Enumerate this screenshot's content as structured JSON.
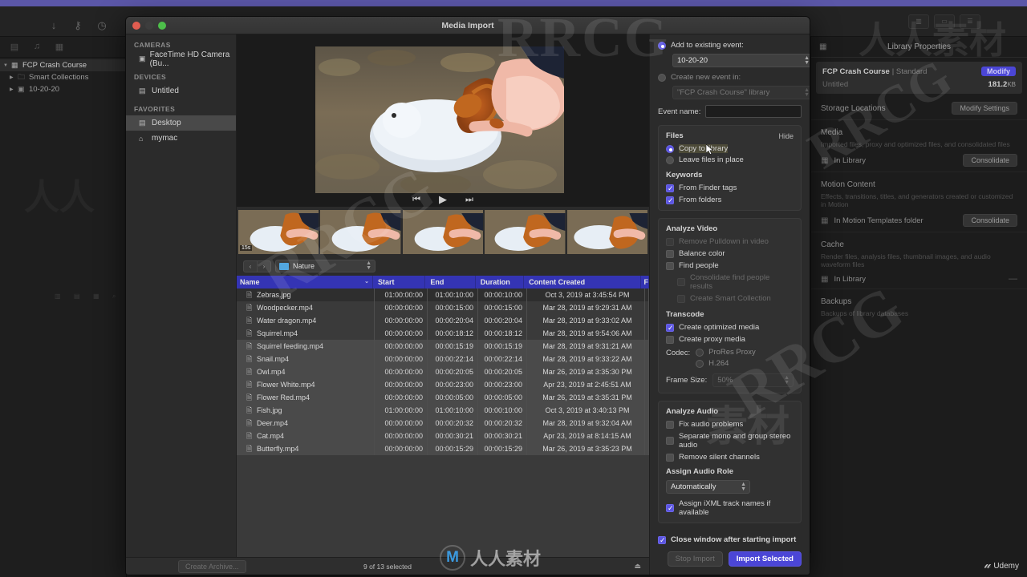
{
  "app": {
    "sidebar": {
      "items": [
        {
          "label": "FCP Crash Course",
          "icon": "library-icon",
          "level": 0
        },
        {
          "label": "Smart Collections",
          "icon": "folder-icon",
          "level": 1
        },
        {
          "label": "10-20-20",
          "icon": "event-icon",
          "level": 1
        }
      ]
    },
    "inspector": {
      "title": "Library Properties",
      "library_name": "FCP Crash Course",
      "library_kind": "Standard",
      "modify_label": "Modify",
      "untitled_label": "Untitled",
      "untitled_size": "181.2",
      "untitled_size_unit": "KB",
      "storage_title": "Storage Locations",
      "storage_button": "Modify Settings",
      "media_title": "Media",
      "media_desc": "Imported files, proxy and optimized files, and consolidated files",
      "media_location": "In Library",
      "media_button": "Consolidate",
      "motion_title": "Motion Content",
      "motion_desc": "Effects, transitions, titles, and generators created or customized in Motion",
      "motion_location": "In Motion Templates folder",
      "motion_button": "Consolidate",
      "cache_title": "Cache",
      "cache_desc": "Render files, analysis files, thumbnail images, and audio waveform files",
      "cache_location": "In Library",
      "backups_title": "Backups",
      "backups_desc": "Backups of library databases"
    }
  },
  "window": {
    "title": "Media Import",
    "sources": {
      "cameras_header": "CAMERAS",
      "cameras": [
        {
          "label": "FaceTime HD Camera (Bu...",
          "icon": "camera-icon"
        }
      ],
      "devices_header": "DEVICES",
      "devices": [
        {
          "label": "Untitled",
          "icon": "drive-icon"
        }
      ],
      "favorites_header": "FAVORITES",
      "favorites": [
        {
          "label": "Desktop",
          "icon": "desktop-icon",
          "selected": true
        },
        {
          "label": "mymac",
          "icon": "home-icon",
          "selected": false
        }
      ]
    },
    "viewer": {
      "skip_back_icon": "skip-back-icon",
      "play_icon": "play-icon",
      "skip_forward_icon": "skip-forward-icon",
      "filmstrip_badge": "15s"
    },
    "path_bar": {
      "back_icon": "chevron-left-icon",
      "forward_icon": "chevron-right-icon",
      "current_folder": "Nature"
    },
    "table": {
      "columns": [
        "Name",
        "Start",
        "End",
        "Duration",
        "Content Created",
        "F"
      ],
      "sort_column": "Name",
      "rows": [
        {
          "name": "Zebras.jpg",
          "start": "01:00:00:00",
          "end": "01:00:10:00",
          "duration": "00:00:10:00",
          "created": "Oct 3, 2019 at 3:45:54 PM",
          "selected": false
        },
        {
          "name": "Woodpecker.mp4",
          "start": "00:00:00:00",
          "end": "00:00:15:00",
          "duration": "00:00:15:00",
          "created": "Mar 28, 2019 at 9:29:31 AM",
          "selected": false
        },
        {
          "name": "Water dragon.mp4",
          "start": "00:00:00:00",
          "end": "00:00:20:04",
          "duration": "00:00:20:04",
          "created": "Mar 28, 2019 at 9:33:02 AM",
          "selected": false
        },
        {
          "name": "Squirrel.mp4",
          "start": "00:00:00:00",
          "end": "00:00:18:12",
          "duration": "00:00:18:12",
          "created": "Mar 28, 2019 at 9:54:06 AM",
          "selected": false
        },
        {
          "name": "Squirrel feeding.mp4",
          "start": "00:00:00:00",
          "end": "00:00:15:19",
          "duration": "00:00:15:19",
          "created": "Mar 28, 2019 at 9:31:21 AM",
          "selected": true
        },
        {
          "name": "Snail.mp4",
          "start": "00:00:00:00",
          "end": "00:00:22:14",
          "duration": "00:00:22:14",
          "created": "Mar 28, 2019 at 9:33:22 AM",
          "selected": true
        },
        {
          "name": "Owl.mp4",
          "start": "00:00:00:00",
          "end": "00:00:20:05",
          "duration": "00:00:20:05",
          "created": "Mar 26, 2019 at 3:35:30 PM",
          "selected": true
        },
        {
          "name": "Flower White.mp4",
          "start": "00:00:00:00",
          "end": "00:00:23:00",
          "duration": "00:00:23:00",
          "created": "Apr 23, 2019 at 2:45:51 AM",
          "selected": true
        },
        {
          "name": "Flower Red.mp4",
          "start": "00:00:00:00",
          "end": "00:00:05:00",
          "duration": "00:00:05:00",
          "created": "Mar 26, 2019 at 3:35:31 PM",
          "selected": true
        },
        {
          "name": "Fish.jpg",
          "start": "01:00:00:00",
          "end": "01:00:10:00",
          "duration": "00:00:10:00",
          "created": "Oct 3, 2019 at 3:40:13 PM",
          "selected": true
        },
        {
          "name": "Deer.mp4",
          "start": "00:00:00:00",
          "end": "00:00:20:32",
          "duration": "00:00:20:32",
          "created": "Mar 28, 2019 at 9:32:04 AM",
          "selected": true
        },
        {
          "name": "Cat.mp4",
          "start": "00:00:00:00",
          "end": "00:00:30:21",
          "duration": "00:00:30:21",
          "created": "Apr 23, 2019 at 8:14:15 AM",
          "selected": true
        },
        {
          "name": "Butterfly.mp4",
          "start": "00:00:00:00",
          "end": "00:00:15:29",
          "duration": "00:00:15:29",
          "created": "Mar 26, 2019 at 3:35:23 PM",
          "selected": true
        }
      ]
    },
    "bottom": {
      "create_archive": "Create Archive...",
      "selection_status": "9 of 13 selected",
      "eject_icon": "eject-icon"
    },
    "options": {
      "add_existing_label": "Add to existing event:",
      "add_existing_selected": true,
      "existing_event_value": "10-20-20",
      "create_new_label": "Create new event in:",
      "create_new_selected": false,
      "library_value": "\"FCP Crash Course\" library",
      "event_name_label": "Event name:",
      "event_name_value": "",
      "files": {
        "title": "Files",
        "hide_label": "Hide",
        "copy_to_library": "Copy to library",
        "copy_selected": true,
        "leave_in_place": "Leave files in place",
        "leave_selected": false
      },
      "keywords": {
        "title": "Keywords",
        "from_finder_tags": "From Finder tags",
        "from_finder_tags_checked": true,
        "from_folders": "From folders",
        "from_folders_checked": true
      },
      "analyze_video": {
        "title": "Analyze Video",
        "items": [
          {
            "label": "Remove Pulldown in video",
            "checked": false,
            "disabled": true,
            "indent": false
          },
          {
            "label": "Balance color",
            "checked": false,
            "disabled": false,
            "indent": false
          },
          {
            "label": "Find people",
            "checked": false,
            "disabled": false,
            "indent": false
          },
          {
            "label": "Consolidate find people results",
            "checked": false,
            "disabled": true,
            "indent": true
          },
          {
            "label": "Create Smart Collection",
            "checked": false,
            "disabled": true,
            "indent": true
          }
        ]
      },
      "transcode": {
        "title": "Transcode",
        "create_optimized": "Create optimized media",
        "create_optimized_checked": true,
        "create_proxy": "Create proxy media",
        "create_proxy_checked": false,
        "codec_label": "Codec:",
        "codec_options": [
          "ProRes Proxy",
          "H.264"
        ],
        "codec_selected": "ProRes Proxy",
        "frame_size_label": "Frame Size:",
        "frame_size_value": "50%"
      },
      "analyze_audio": {
        "title": "Analyze Audio",
        "items": [
          {
            "label": "Fix audio problems",
            "checked": false
          },
          {
            "label": "Separate mono and group stereo audio",
            "checked": false
          },
          {
            "label": "Remove silent channels",
            "checked": false
          }
        ],
        "role_title": "Assign Audio Role",
        "role_value": "Automatically",
        "ixml_label": "Assign iXML track names if available",
        "ixml_checked": true
      },
      "footer": {
        "close_window_label": "Close window after starting import",
        "close_window_checked": true,
        "stop_import": "Stop Import",
        "import_selected": "Import Selected"
      }
    }
  },
  "watermarks": {
    "rrcg": "RRCG",
    "cn": "人人素材",
    "udemy": "Udemy"
  },
  "colors": {
    "accent": "#4b46d6",
    "header_blue": "#3434b4",
    "topbar": "#5b57a8"
  }
}
